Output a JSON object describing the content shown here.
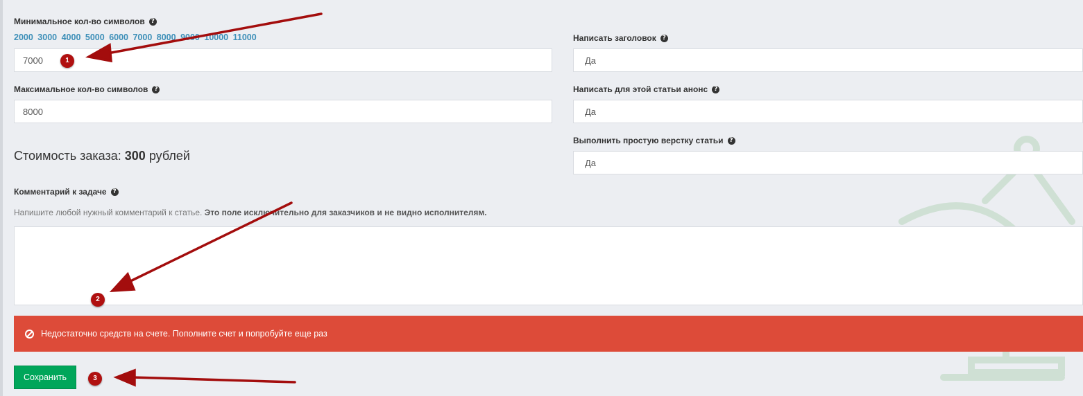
{
  "form": {
    "min_chars": {
      "label": "Минимальное кол-во символов",
      "presets": [
        "2000",
        "3000",
        "4000",
        "5000",
        "6000",
        "7000",
        "8000",
        "9000",
        "10000",
        "11000"
      ],
      "value": "7000"
    },
    "max_chars": {
      "label": "Максимальное кол-во символов",
      "value": "8000"
    },
    "cost": {
      "prefix": "Стоимость заказа:",
      "amount": "300",
      "currency": "рублей"
    },
    "write_title": {
      "label": "Написать заголовок",
      "value": "Да"
    },
    "write_announce": {
      "label": "Написать для этой статьи анонс",
      "value": "Да"
    },
    "simple_layout": {
      "label": "Выполнить простую верстку статьи",
      "value": "Да"
    },
    "comment": {
      "label": "Комментарий к задаче",
      "hint_plain": "Напишите любой нужный комментарий к статье.",
      "hint_bold": "Это поле исключительно для заказчиков и не видно исполнителям.",
      "value": ""
    }
  },
  "alert": {
    "message": "Недостаточно средств на счете. Пополните счет и попробуйте еще раз",
    "color": "#dd4b39"
  },
  "actions": {
    "save_label": "Сохранить",
    "save_color": "#00a65a"
  },
  "annotations": {
    "markers": [
      "1",
      "2",
      "3"
    ],
    "color": "#b01010"
  }
}
